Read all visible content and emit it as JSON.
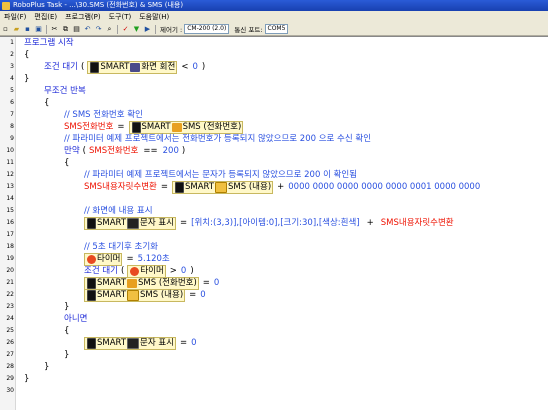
{
  "window": {
    "title": "RoboPlus Task - ...\\30.SMS (전화번호) & SMS (내용)"
  },
  "menu": [
    "파일(F)",
    "편집(E)",
    "프로그램(P)",
    "도구(T)",
    "도움말(H)"
  ],
  "toolbar": {
    "controller_label": "제어기 :",
    "controller_value": "CM-200 (2.0)",
    "port_label": "통신 포트:",
    "port_value": "COM5"
  },
  "line_numbers": [
    "1",
    "2",
    "3",
    "4",
    "5",
    "6",
    "7",
    "8",
    "9",
    "10",
    "11",
    "12",
    "13",
    "14",
    "15",
    "16",
    "17",
    "18",
    "19",
    "20",
    "21",
    "22",
    "23",
    "24",
    "25",
    "26",
    "27",
    "28",
    "29",
    "30"
  ],
  "code": {
    "l1": {
      "t": "프로그램 시작"
    },
    "l2": {
      "t": "{"
    },
    "l3": {
      "kw": "조건 대기",
      "p1": "(",
      "dev": "SMART",
      "blk": "화면 회전",
      "op": "<",
      "val": "0",
      "p2": ")"
    },
    "l4": {
      "t": "}"
    },
    "l5": {
      "t": "무조건 반복"
    },
    "l6": {
      "t": "{"
    },
    "l7": {
      "t": "// SMS 전화번호 확인"
    },
    "l8": {
      "var": "SMS전화번호",
      "eq": "=",
      "dev": "SMART",
      "blk": "SMS (전화번호)"
    },
    "l9": {
      "t": "// 파라미터 예제 프로젝트에서는 전화번호가 등록되지 않았으므로 200 으로 수신 확인"
    },
    "l10": {
      "kw": "만약",
      "p1": "(",
      "var": "SMS전화번호",
      "op": "==",
      "val": "200",
      "p2": ")"
    },
    "l11": {
      "t": "{"
    },
    "l12": {
      "t": "// 파라미터 예제 프로젝트에서는 문자가 등록되지 않았으므로 200 이 확인됨"
    },
    "l13": {
      "var": "SMS내용자릿수변환",
      "eq": "=",
      "dev": "SMART",
      "blk": "SMS (내용)",
      "op": "+",
      "val": "0000 0000 0000 0000 0000 0001 0000 0000"
    },
    "l14": {
      "t": ""
    },
    "l15": {
      "t": "// 화면에 내용 표시"
    },
    "l16": {
      "dev": "SMART",
      "blk": "문자 표시",
      "eq": "=",
      "val": "[위치:(3,3)],[아이템:0],[크기:30],[색상:흰색]",
      "op": "+",
      "var": "SMS내용자릿수변환"
    },
    "l17": {
      "t": ""
    },
    "l18": {
      "t": "// 5초 대기후 초기화"
    },
    "l19": {
      "blk": "타이머",
      "eq": "=",
      "val": "5.120초"
    },
    "l20": {
      "kw": "조건 대기",
      "p1": "(",
      "blk": "타이머",
      "op": ">",
      "val": "0",
      "p2": ")"
    },
    "l21": {
      "dev": "SMART",
      "blk": "SMS (전화번호)",
      "eq": "=",
      "val": "0"
    },
    "l22": {
      "dev": "SMART",
      "blk": "SMS (내용)",
      "eq": "=",
      "val": "0"
    },
    "l23": {
      "t": "}"
    },
    "l24": {
      "t": "아니면"
    },
    "l25": {
      "t": "{"
    },
    "l26": {
      "dev": "SMART",
      "blk": "문자 표시",
      "eq": "=",
      "val": "0"
    },
    "l27": {
      "t": "}"
    },
    "l28": {
      "t": "}"
    },
    "l29": {
      "t": "}"
    },
    "l30": {
      "t": ""
    }
  }
}
